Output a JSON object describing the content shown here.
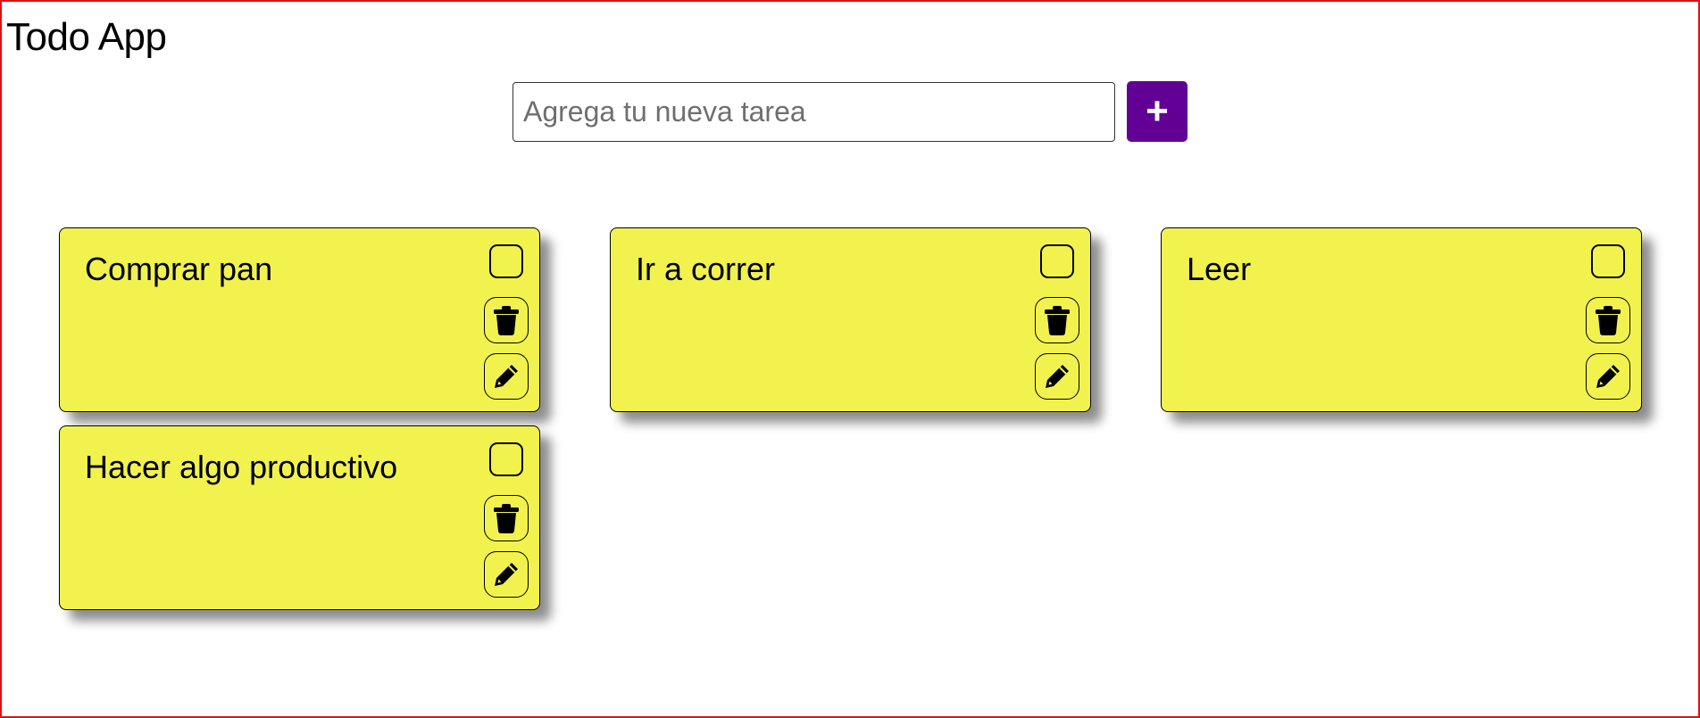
{
  "app": {
    "title": "Todo App"
  },
  "add_task": {
    "placeholder": "Agrega tu nueva tarea",
    "value": "",
    "button_label": "+",
    "button_color": "#620096"
  },
  "theme": {
    "card_color": "#f2f24f",
    "frame_border_color": "#e01010"
  },
  "tasks": [
    {
      "text": "Comprar pan",
      "done": false,
      "delete_icon": "trash-icon",
      "edit_icon": "pencil-icon"
    },
    {
      "text": "Ir a correr",
      "done": false,
      "delete_icon": "trash-icon",
      "edit_icon": "pencil-icon"
    },
    {
      "text": "Leer",
      "done": false,
      "delete_icon": "trash-icon",
      "edit_icon": "pencil-icon"
    },
    {
      "text": "Hacer algo productivo",
      "done": false,
      "delete_icon": "trash-icon",
      "edit_icon": "pencil-icon"
    }
  ]
}
